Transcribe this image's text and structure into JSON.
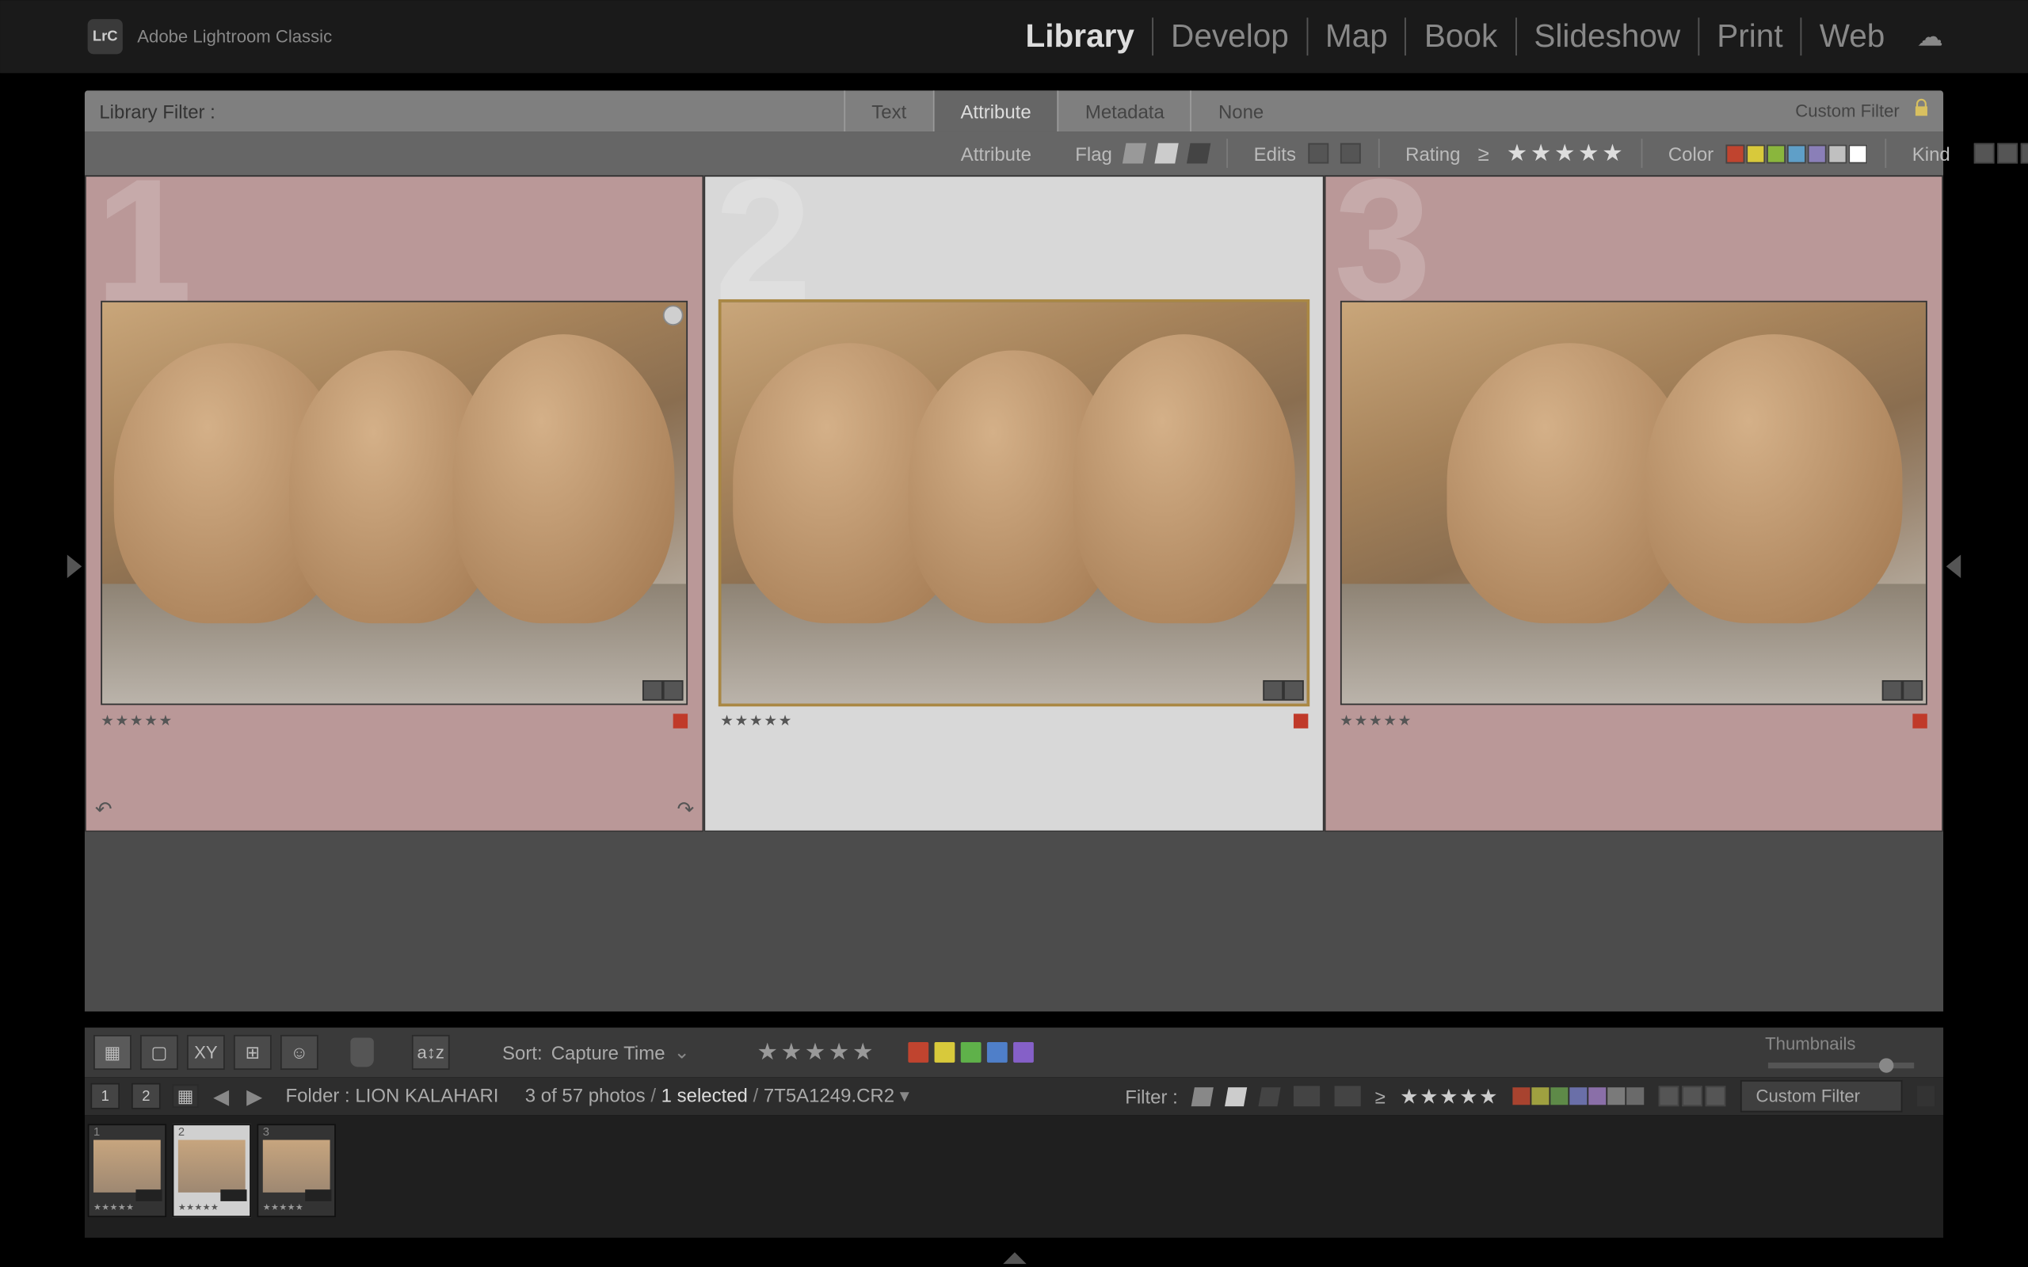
{
  "app": {
    "icon": "LrC",
    "title": "Adobe Lightroom Classic"
  },
  "modules": {
    "items": [
      "Library",
      "Develop",
      "Map",
      "Book",
      "Slideshow",
      "Print",
      "Web"
    ],
    "active": "Library"
  },
  "filter_bar": {
    "label": "Library Filter :",
    "tabs": {
      "text": "Text",
      "attribute": "Attribute",
      "metadata": "Metadata",
      "none": "None"
    },
    "active_tab": "Attribute",
    "custom_filter_label": "Custom Filter"
  },
  "attribute_bar": {
    "attribute_label": "Attribute",
    "flag_label": "Flag",
    "edits_label": "Edits",
    "rating_label": "Rating",
    "rating_operator": "≥",
    "rating_value": 5,
    "color_label": "Color",
    "kind_label": "Kind",
    "color_swatches": [
      "#c0442f",
      "#d8c93b",
      "#8ab63d",
      "#5f9fc8",
      "#8a7fb8",
      "#c0c0c0",
      "#ffffff"
    ]
  },
  "grid": {
    "cells": [
      {
        "index": "1",
        "rating": 5,
        "color_label": "red",
        "selected": false
      },
      {
        "index": "2",
        "rating": 5,
        "color_label": "red",
        "selected": true
      },
      {
        "index": "3",
        "rating": 5,
        "color_label": "red",
        "selected": false
      }
    ]
  },
  "toolbar": {
    "sort_label": "Sort:",
    "sort_value": "Capture Time",
    "rating_value": 5,
    "color_swatches": [
      "#c0442f",
      "#d8c93b",
      "#5fb14a",
      "#4f7fc9",
      "#8560c8"
    ],
    "thumbnails_label": "Thumbnails"
  },
  "filmstrip_header": {
    "monitor1": "1",
    "monitor2": "2",
    "folder_label": "Folder :",
    "folder_name": "LION KALAHARI",
    "count_text": "3 of 57 photos",
    "selected_text": "1 selected",
    "filename": "7T5A1249.CR2",
    "filter_label": "Filter :",
    "rating_operator": "≥",
    "rating_value": 5,
    "swatches": [
      "#a8432f",
      "#9fa040",
      "#5e8a48",
      "#6a6fa8",
      "#8a6fa8",
      "#7a7a7a",
      "#6a6a6a"
    ],
    "custom_filter_label": "Custom Filter"
  },
  "filmstrip": {
    "thumbs": [
      {
        "index": "1",
        "rating": 5,
        "selected": false
      },
      {
        "index": "2",
        "rating": 5,
        "selected": true
      },
      {
        "index": "3",
        "rating": 5,
        "selected": false
      }
    ]
  }
}
